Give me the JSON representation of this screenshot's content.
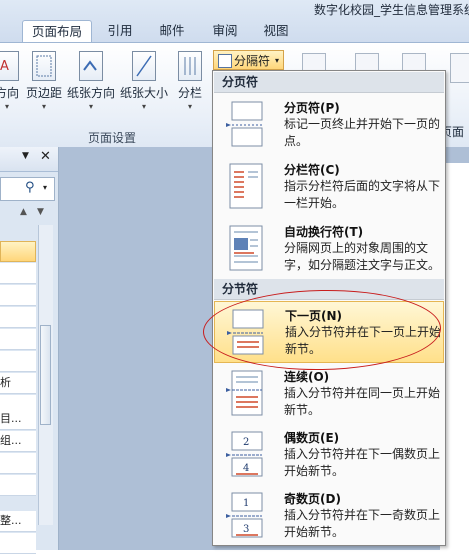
{
  "window": {
    "title": "数字化校园_学生信息管理系统"
  },
  "tabs": [
    {
      "label": "页面布局",
      "active": true
    },
    {
      "label": "引用"
    },
    {
      "label": "邮件"
    },
    {
      "label": "审阅"
    },
    {
      "label": "视图"
    }
  ],
  "ribbon": {
    "buttons": [
      {
        "label": "方向",
        "icon": "text-direction-icon"
      },
      {
        "label": "页边距",
        "icon": "margins-icon"
      },
      {
        "label": "纸张方向",
        "icon": "orientation-icon"
      },
      {
        "label": "纸张大小",
        "icon": "size-icon"
      },
      {
        "label": "分栏",
        "icon": "columns-icon"
      }
    ],
    "group_label": "页面设置",
    "breaks_label": "分隔符",
    "right_label": "页面"
  },
  "left_pane": {
    "rows": [
      "",
      "",
      "",
      "",
      "",
      "",
      "析",
      "",
      "目...",
      "组...",
      "",
      "",
      "整...",
      ""
    ]
  },
  "menu": {
    "page_breaks_header": "分页符",
    "section_breaks_header": "分节符",
    "items": [
      {
        "title": "分页符(P)",
        "desc": "标记一页终止并开始下一页的点。",
        "icon": "page-break-icon"
      },
      {
        "title": "分栏符(C)",
        "desc": "指示分栏符后面的文字将从下一栏开始。",
        "icon": "column-break-icon"
      },
      {
        "title": "自动换行符(T)",
        "desc": "分隔网页上的对象周围的文字，如分隔题注文字与正文。",
        "icon": "text-wrapping-break-icon"
      },
      {
        "title": "下一页(N)",
        "desc": "插入分节符并在下一页上开始新节。",
        "icon": "next-page-icon",
        "highlighted": true
      },
      {
        "title": "连续(O)",
        "desc": "插入分节符并在同一页上开始新节。",
        "icon": "continuous-icon"
      },
      {
        "title": "偶数页(E)",
        "desc": "插入分节符并在下一偶数页上开始新节。",
        "icon": "even-page-icon",
        "page_numbers": [
          "2",
          "4"
        ]
      },
      {
        "title": "奇数页(D)",
        "desc": "插入分节符并在下一奇数页上开始新节。",
        "icon": "odd-page-icon",
        "page_numbers": [
          "1",
          "3"
        ]
      }
    ]
  },
  "colors": {
    "highlight": "#ffe08a",
    "annotation": "#c81e1e",
    "ribbon_border": "#9fb6d3"
  }
}
